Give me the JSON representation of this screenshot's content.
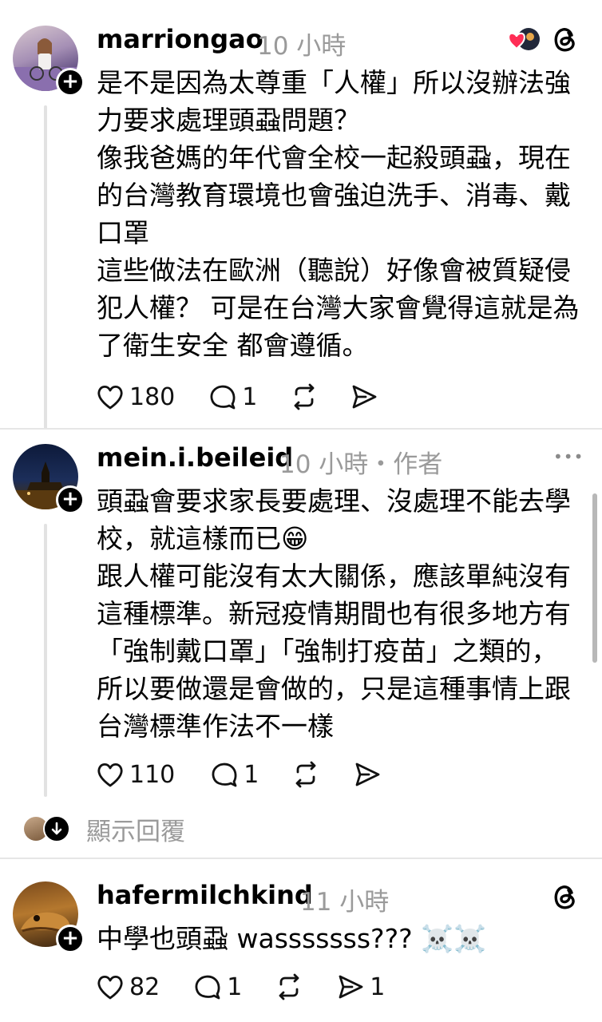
{
  "posts": [
    {
      "username": "marriongao",
      "time": "10 小時",
      "paragraphs": [
        "是不是因為太尊重「人權」所以沒辦法強力要求處理頭蝨問題？",
        "像我爸媽的年代會全校一起殺頭蝨，現在的台灣教育環境也會強迫洗手、消毒、戴口罩",
        "這些做法在歐洲（聽說）好像會被質疑侵犯人權？ 可是在台灣大家會覺得這就是為了衛生安全 都會遵循。"
      ],
      "likes": "180",
      "replies": "1"
    },
    {
      "username": "mein.i.beileid",
      "time": "10 小時",
      "author_tag": "・作者",
      "paragraphs": [
        "頭蝨會要求家長要處理、沒處理不能去學校，就這樣而已😁",
        "跟人權可能沒有太大關係，應該單純沒有這種標準。新冠疫情期間也有很多地方有「強制戴口罩」「強制打疫苗」之類的，所以要做還是會做的，只是這種事情上跟台灣標準作法不一樣"
      ],
      "likes": "110",
      "replies": "1"
    },
    {
      "username": "hafermilchkind",
      "time": "11 小時",
      "paragraphs": [
        "中學也頭蝨 wasssssss??? ☠️☠️"
      ],
      "likes": "82",
      "replies": "1",
      "shares": "1"
    }
  ],
  "show_replies_label": "顯示回覆",
  "more_options": "•••",
  "colors": {
    "accent_heart": "#ff2d55",
    "meta_gray": "#9a9a9a",
    "line_gray": "#e2e2e2"
  },
  "icons": [
    "heart-icon",
    "comment-icon",
    "repost-icon",
    "share-icon",
    "threads-icon",
    "plus-icon",
    "more-icon",
    "arrow-down-icon"
  ]
}
